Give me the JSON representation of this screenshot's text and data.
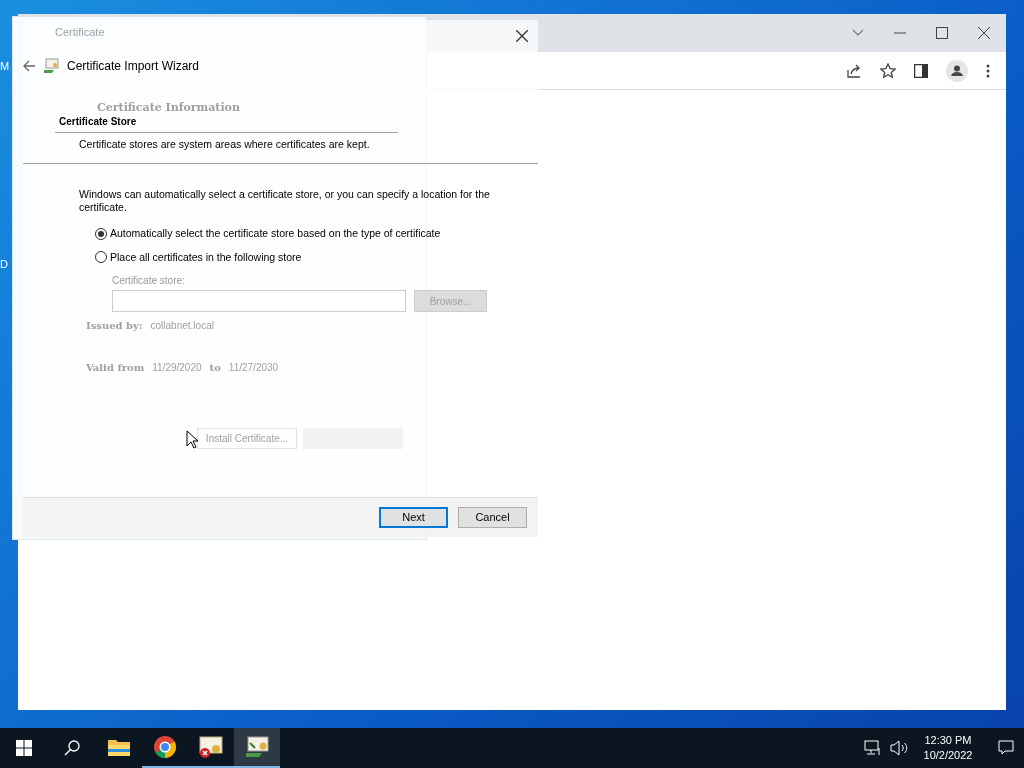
{
  "desktop_labels": [
    "M",
    "D"
  ],
  "certificate_dialog": {
    "title": "Certificate",
    "heading": "Certificate Information",
    "issued_by": {
      "label": "Issued by:",
      "value": "collabnet.local"
    },
    "valid": {
      "label": "Valid from",
      "from": "11/29/2020",
      "to_label": "to",
      "to": "11/27/2030"
    },
    "install_button": "Install Certificate..."
  },
  "wizard": {
    "title": "Certificate Import Wizard",
    "section_title": "Certificate Store",
    "section_description": "Certificate stores are system areas where certificates are kept.",
    "intro": "Windows can automatically select a certificate store, or you can specify a location for the certificate.",
    "options": [
      {
        "label": "Automatically select the certificate store based on the type of certificate",
        "selected": true
      },
      {
        "label": "Place all certificates in the following store",
        "selected": false
      }
    ],
    "store_label": "Certificate store:",
    "store_disabled": true,
    "browse": "Browse...",
    "buttons": [
      {
        "label": "Next",
        "default": true
      },
      {
        "label": "Cancel",
        "default": false
      }
    ]
  },
  "taskbar": {
    "apps": [
      {
        "kind": "explorer",
        "running": false,
        "selected": false
      },
      {
        "kind": "chrome",
        "running": true,
        "selected": false
      },
      {
        "kind": "certificate",
        "running": true,
        "selected": false
      },
      {
        "kind": "wizard",
        "running": true,
        "selected": true
      }
    ],
    "time": "12:30 PM",
    "date": "10/2/2022"
  }
}
